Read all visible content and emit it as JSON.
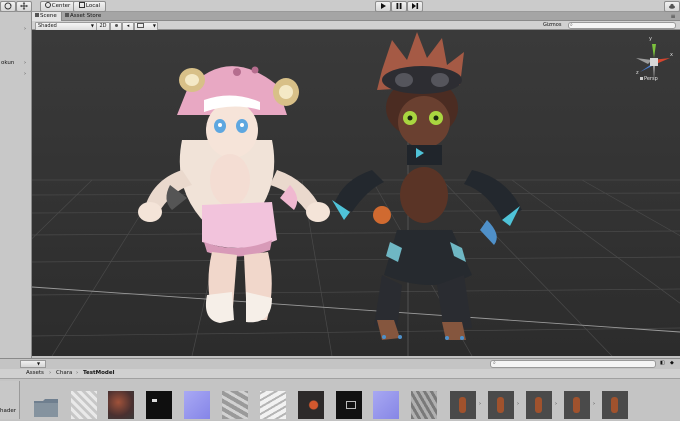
{
  "toolbar": {
    "pivot_label": "Center",
    "space_label": "Local",
    "play_icon": "play-icon",
    "pause_icon": "pause-icon",
    "step_icon": "step-icon"
  },
  "tabs": {
    "scene_label": "Scene",
    "asset_store_label": "Asset Store"
  },
  "scene_controls": {
    "shading_mode": "Shaded",
    "mode_2d_label": "2D",
    "gizmos_label": "Gizmos",
    "search_icon": "search-icon"
  },
  "hierarchy": {
    "item_fragment": "okun"
  },
  "gizmo": {
    "projection_label": "Persp",
    "x_label": "x",
    "y_label": "y",
    "z_label": "z"
  },
  "project": {
    "breadcrumb": [
      "Assets",
      "Chara",
      "TestModel"
    ],
    "left_label": "hader"
  },
  "colors": {
    "viewport_bg": "#2f2f2f",
    "toolbar_bg": "#cbcbcb",
    "tab_active_bg": "#e4e4e4",
    "gizmo_y": "#7cc23d",
    "gizmo_x": "#d6452e",
    "gizmo_z": "#4a7fd4",
    "left_char_primary": "#f1c8dd",
    "right_char_primary": "#2b2421"
  }
}
